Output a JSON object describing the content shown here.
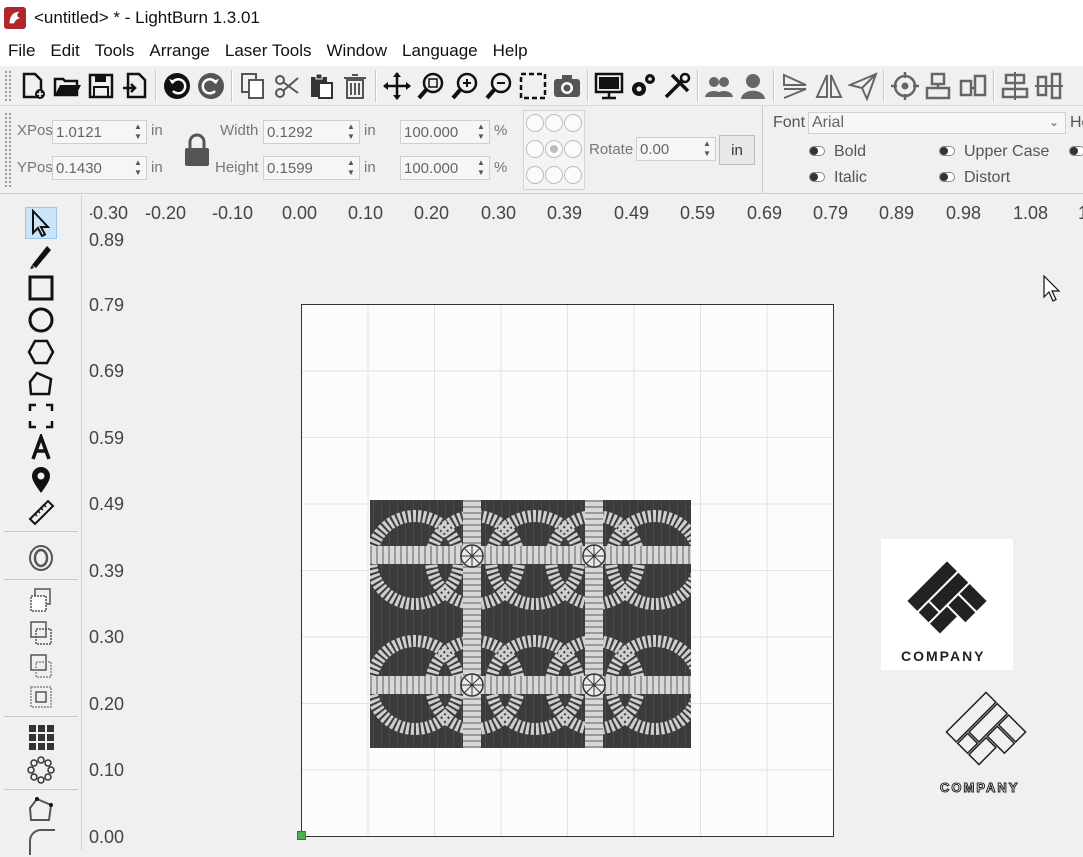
{
  "window": {
    "title": "<untitled> * - LightBurn 1.3.01"
  },
  "menu": [
    "File",
    "Edit",
    "Tools",
    "Arrange",
    "Laser Tools",
    "Window",
    "Language",
    "Help"
  ],
  "toolbar": {
    "icons": [
      "new-file-icon",
      "open-folder-icon",
      "save-icon",
      "import-icon",
      "undo-icon",
      "redo-icon",
      "copy-icon",
      "cut-icon",
      "paste-icon",
      "delete-icon",
      "move-icon",
      "zoom-to-page-icon",
      "zoom-in-icon",
      "zoom-out-icon",
      "frame-selection-icon",
      "camera-icon",
      "monitor-icon",
      "settings-icon",
      "tools-icon",
      "group-icon",
      "user-icon",
      "mirror-h-icon",
      "mirror-v-icon",
      "send-icon",
      "target-icon",
      "align-icon",
      "align-alt-icon",
      "distribute-icon",
      "distribute-alt-icon"
    ]
  },
  "numeric": {
    "xpos_label": "XPos",
    "xpos_value": "1.0121",
    "ypos_label": "YPos",
    "ypos_value": "0.1430",
    "unit": "in",
    "width_label": "Width",
    "width_value": "0.1292",
    "height_label": "Height",
    "height_value": "0.1599",
    "scale_w": "100.000",
    "scale_h": "100.000",
    "percent": "%",
    "rotate_label": "Rotate",
    "rotate_value": "0.00",
    "units_button": "in"
  },
  "text_options": {
    "font_label": "Font",
    "font_value": "Arial",
    "height_label_partial": "He",
    "bold": "Bold",
    "italic": "Italic",
    "upper_case": "Upper Case",
    "distort": "Distort"
  },
  "ruler": {
    "top": [
      "-0.30",
      "-0.20",
      "-0.10",
      "0.00",
      "0.10",
      "0.20",
      "0.30",
      "0.39",
      "0.49",
      "0.59",
      "0.69",
      "0.79",
      "0.89",
      "0.98",
      "1.08",
      "1"
    ],
    "left": [
      "0.89",
      "0.79",
      "0.69",
      "0.59",
      "0.49",
      "0.39",
      "0.30",
      "0.20",
      "0.10",
      "0.00"
    ]
  },
  "logos": {
    "filled_text": "COMPANY",
    "outline_text": "COMPANY"
  },
  "colors": {
    "accent": "#cce4f7",
    "origin": "#4caf50"
  }
}
